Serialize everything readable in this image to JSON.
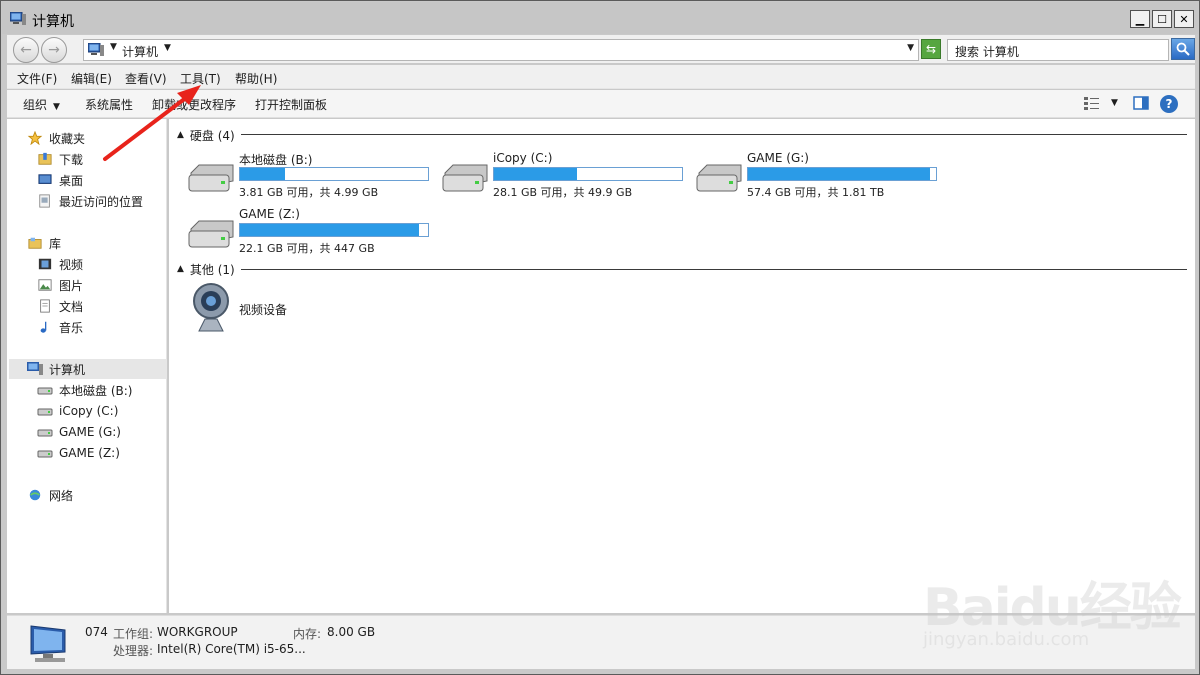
{
  "window": {
    "title": "计算机"
  },
  "address": {
    "path": "计算机"
  },
  "search": {
    "placeholder": "搜索 计算机"
  },
  "menu": {
    "items": [
      "文件(F)",
      "编辑(E)",
      "查看(V)",
      "工具(T)",
      "帮助(H)"
    ]
  },
  "toolbar": {
    "organize": "组织",
    "system_props": "系统属性",
    "uninstall": "卸载或更改程序",
    "control_panel": "打开控制面板"
  },
  "nav": {
    "favorites": {
      "label": "收藏夹",
      "items": [
        "下载",
        "桌面",
        "最近访问的位置"
      ]
    },
    "libraries": {
      "label": "库",
      "items": [
        "视频",
        "图片",
        "文档",
        "音乐"
      ]
    },
    "computer": {
      "label": "计算机",
      "items": [
        "本地磁盘 (B:)",
        "iCopy (C:)",
        "GAME (G:)",
        "GAME (Z:)"
      ]
    },
    "network": {
      "label": "网络"
    }
  },
  "content": {
    "hard_disks_header": "硬盘 (4)",
    "drives": [
      {
        "name": "本地磁盘 (B:)",
        "info": "3.81 GB 可用，共 4.99 GB",
        "used_fraction": 0.24
      },
      {
        "name": "iCopy (C:)",
        "info": "28.1 GB 可用，共 49.9 GB",
        "used_fraction": 0.44
      },
      {
        "name": "GAME (G:)",
        "info": "57.4 GB 可用，共 1.81 TB",
        "used_fraction": 0.97
      },
      {
        "name": "GAME (Z:)",
        "info": "22.1 GB 可用，共 447 GB",
        "used_fraction": 0.95
      }
    ],
    "other_header": "其他 (1)",
    "other_items": [
      "视频设备"
    ]
  },
  "details": {
    "computer_name": "074",
    "workgroup_label": "工作组:",
    "workgroup": "WORKGROUP",
    "memory_label": "内存:",
    "memory": "8.00 GB",
    "processor_label": "处理器:",
    "processor": "Intel(R) Core(TM) i5-65..."
  },
  "watermark": {
    "text": "Baidu经验",
    "sub": "jingyan.baidu.com"
  },
  "colors": {
    "accent": "#2b9be7",
    "arrow": "#e8231b"
  }
}
